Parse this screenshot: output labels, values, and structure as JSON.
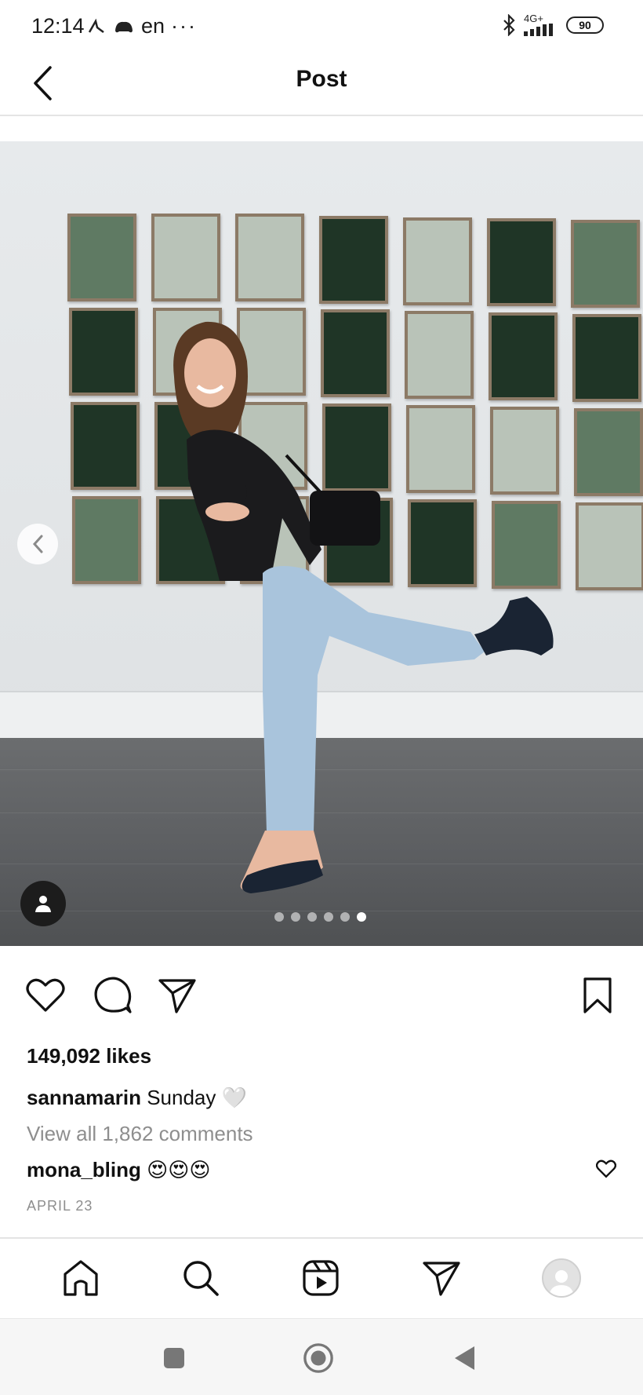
{
  "status_bar": {
    "time": "12:14",
    "language": "en",
    "more": "···",
    "network": "4G+",
    "battery": "90"
  },
  "header": {
    "title": "Post"
  },
  "post": {
    "carousel": {
      "total_slides": 6,
      "active_slide_index": 5
    },
    "likes": "149,092 likes",
    "caption": {
      "username": "sannamarin",
      "text": "Sunday 🤍"
    },
    "view_comments": "View all 1,862 comments",
    "comment": {
      "username": "mona_bling",
      "text": "😍😍😍"
    },
    "date": "APRIL 23"
  },
  "icons": {
    "back": "chevron-left-icon",
    "like": "heart-icon",
    "comment": "comment-bubble-icon",
    "share": "send-icon",
    "save": "bookmark-icon",
    "home": "home-icon",
    "search": "search-icon",
    "reels": "reels-icon",
    "messages": "send-icon",
    "profile": "avatar"
  },
  "colors": {
    "text_primary": "#111111",
    "text_secondary": "#8e8e8e",
    "divider": "#e4e4e4"
  }
}
